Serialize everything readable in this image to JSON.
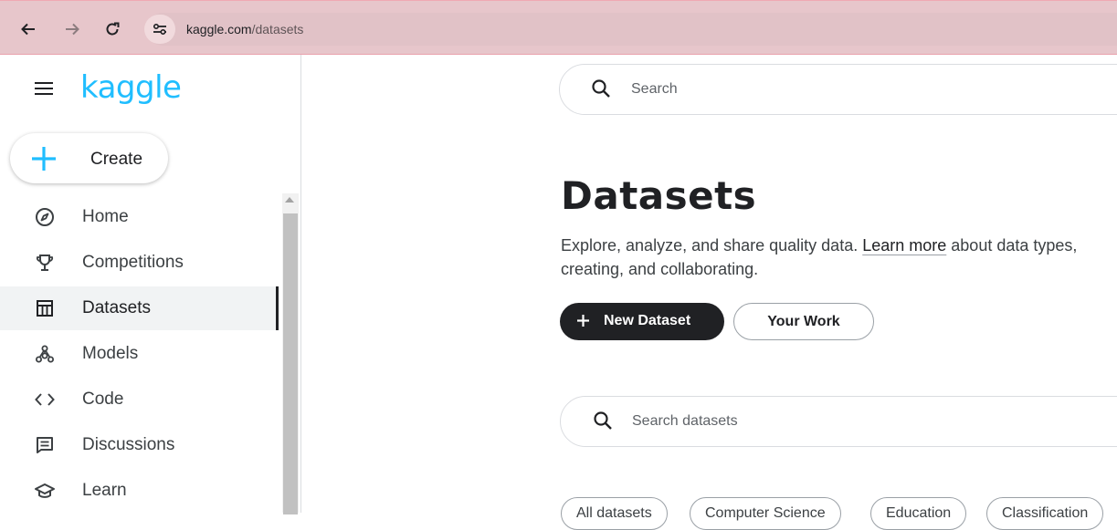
{
  "browser": {
    "url_host": "kaggle.com",
    "url_path": "/datasets"
  },
  "sidebar": {
    "logo": "kaggle",
    "create_label": "Create",
    "items": [
      {
        "label": "Home",
        "icon": "compass-icon"
      },
      {
        "label": "Competitions",
        "icon": "trophy-icon"
      },
      {
        "label": "Datasets",
        "icon": "table-icon",
        "active": true
      },
      {
        "label": "Models",
        "icon": "models-icon"
      },
      {
        "label": "Code",
        "icon": "code-icon"
      },
      {
        "label": "Discussions",
        "icon": "discussions-icon"
      },
      {
        "label": "Learn",
        "icon": "graduation-cap-icon"
      }
    ]
  },
  "main": {
    "search_placeholder": "Search",
    "title": "Datasets",
    "description_pre": "Explore, analyze, and share quality data. ",
    "learn_more": "Learn more",
    "description_post": " about data types, creating, and collaborating.",
    "new_dataset_label": "New Dataset",
    "your_work_label": "Your Work",
    "dataset_search_placeholder": "Search datasets",
    "chips": [
      "All datasets",
      "Computer Science",
      "Education",
      "Classification"
    ]
  },
  "colors": {
    "brand": "#20beff",
    "browser_bar": "#e7c6cb",
    "primary_button": "#202124"
  }
}
